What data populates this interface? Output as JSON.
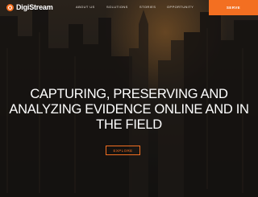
{
  "brand": {
    "name": "DigiStream",
    "accent_color": "#f36f21",
    "logo_icon": "digistream-logo-icon"
  },
  "nav": {
    "items": [
      {
        "label": "ABOUT US"
      },
      {
        "label": "SOLUTIONS"
      },
      {
        "label": "STORIES"
      },
      {
        "label": "OPPORTUNITY"
      }
    ],
    "cta_label": "SERVE"
  },
  "hero": {
    "headline_lines": [
      "CAPTURING, PRESERVING AND",
      "ANALYZING EVIDENCE ONLINE AND IN",
      "THE FIELD"
    ],
    "button_label": "EXPLORE"
  }
}
